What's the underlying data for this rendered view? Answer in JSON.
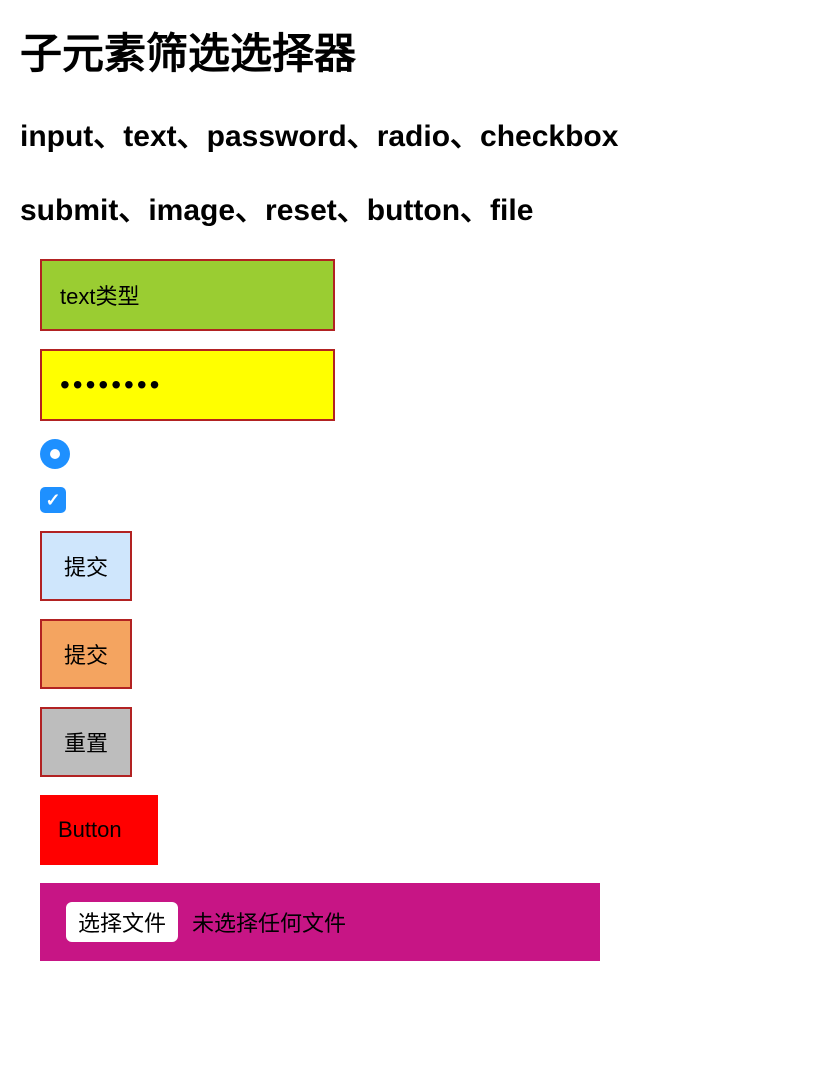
{
  "heading": "子元素筛选选择器",
  "subhead1": "input、text、password、radio、checkbox",
  "subhead2": "submit、image、reset、button、file",
  "inputs": {
    "text_value": "text类型",
    "password_value": "••••••••",
    "submit1_label": "提交",
    "submit2_label": "提交",
    "reset_label": "重置",
    "button_label": "Button",
    "file_button_label": "选择文件",
    "file_status_text": "未选择任何文件"
  },
  "colors": {
    "text_bg": "#9acd32",
    "password_bg": "#ffff00",
    "accent_blue": "#1e90ff",
    "submit1_bg": "#cfe6fc",
    "submit2_bg": "#f4a460",
    "reset_bg": "#bdbdbd",
    "button_bg": "#ff0000",
    "file_bg": "#c71585",
    "border_red": "#b22222"
  }
}
